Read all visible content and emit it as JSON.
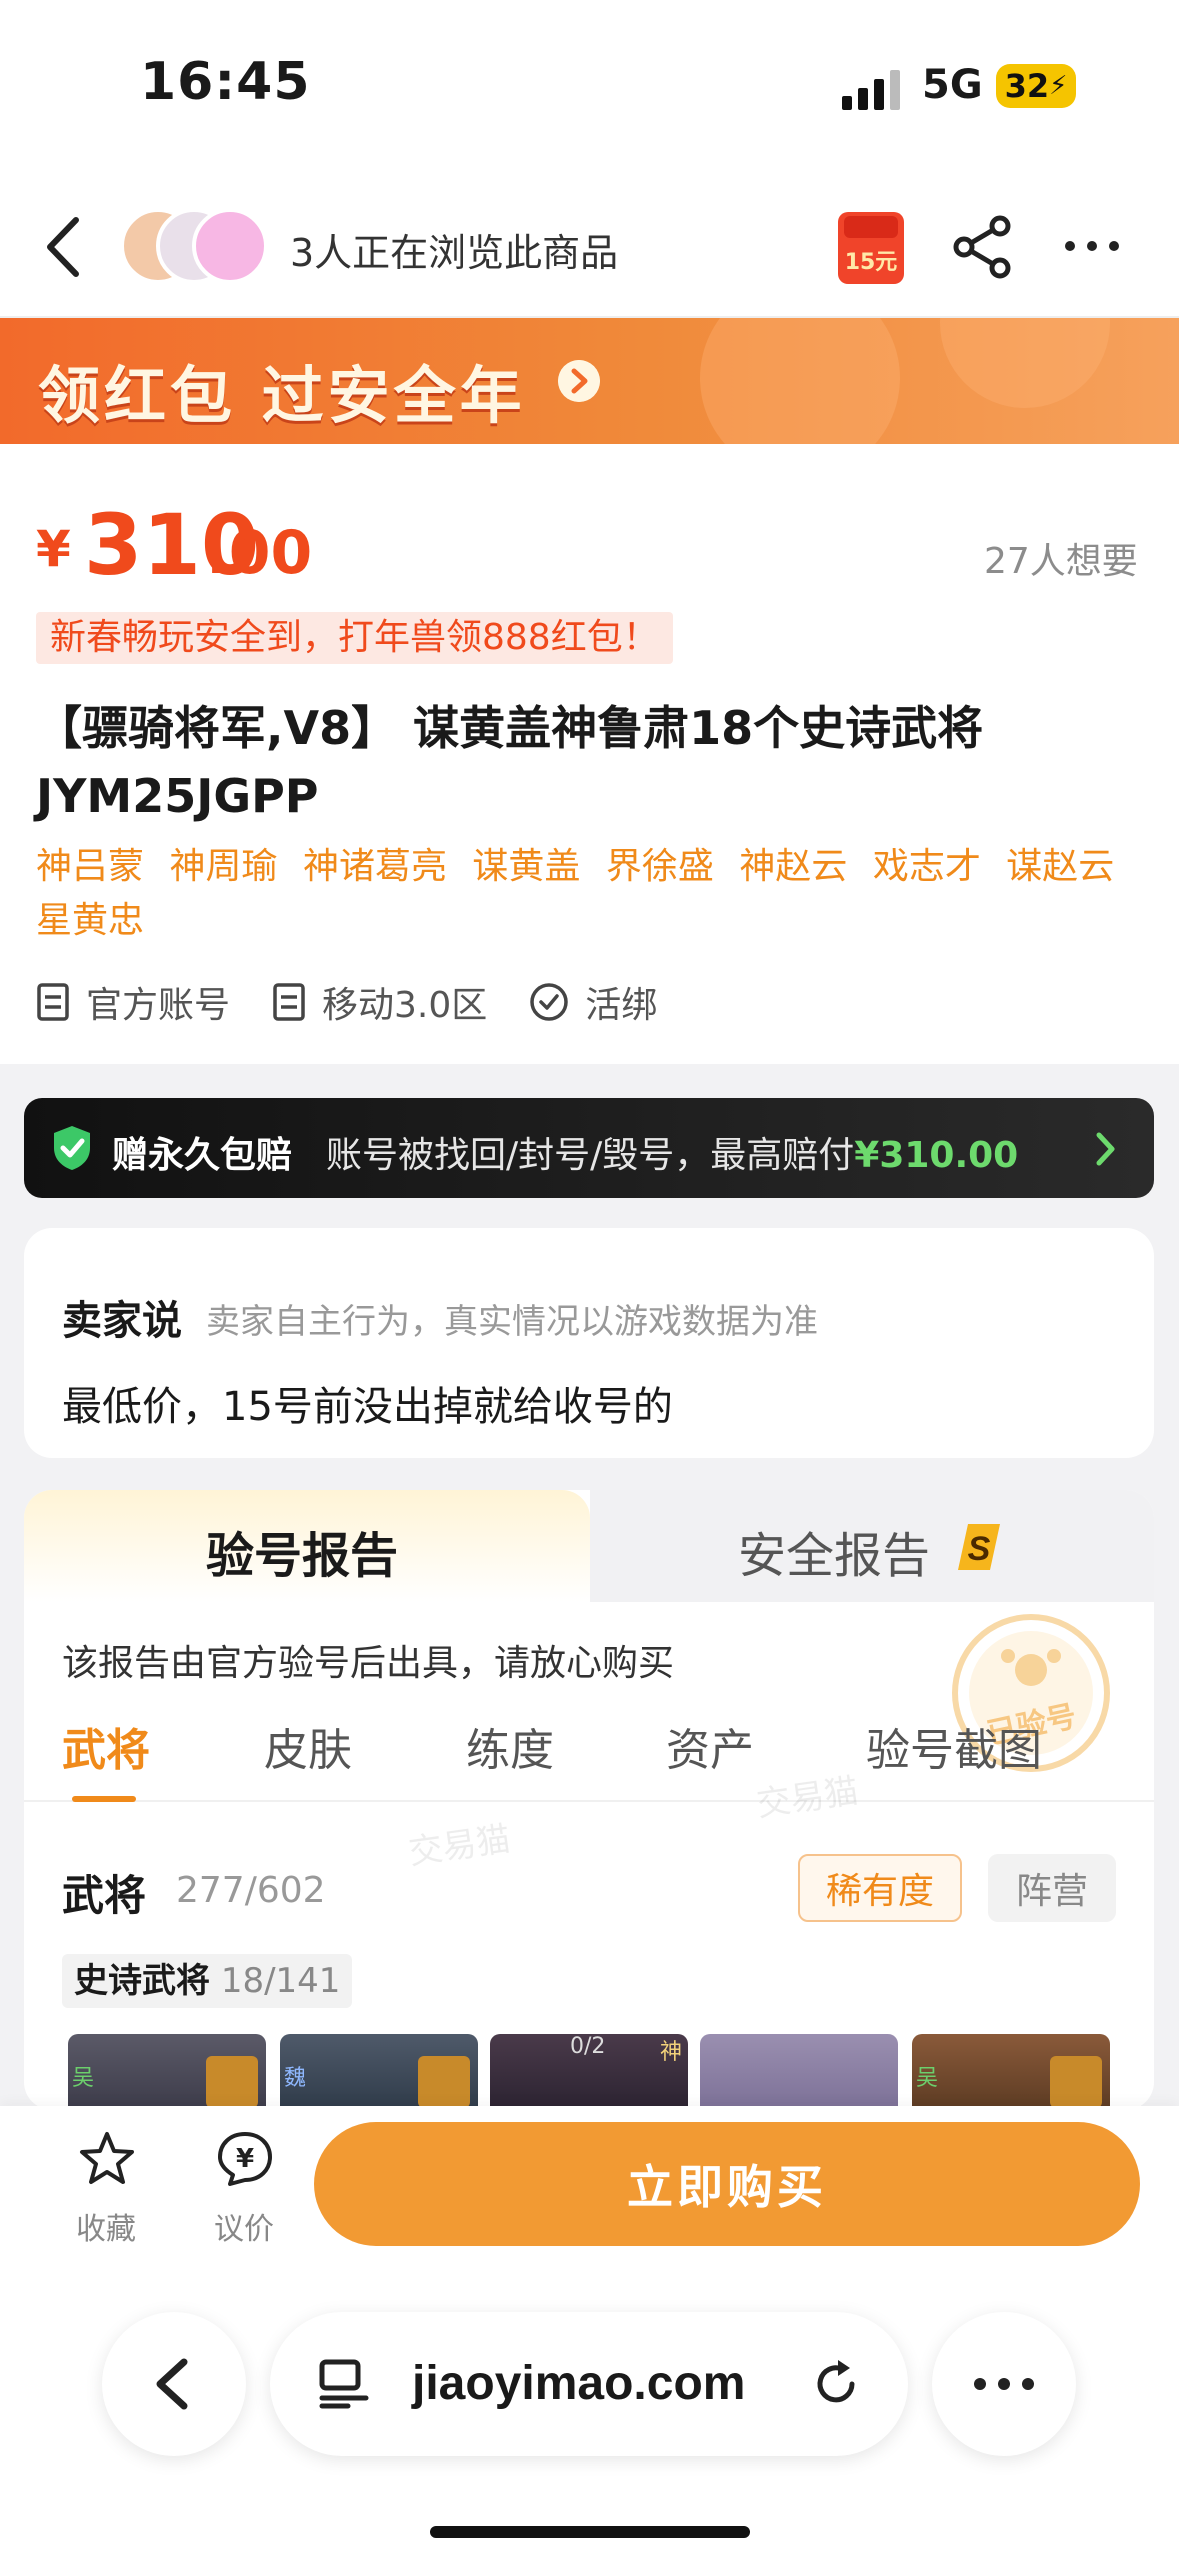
{
  "status_bar": {
    "time": "16:45",
    "network": "5G",
    "battery": "32"
  },
  "header": {
    "viewers_text": "3人正在浏览此商品",
    "coupon_label": "15元",
    "icons": [
      "back-icon",
      "coupon-icon",
      "share-icon",
      "more-icon"
    ]
  },
  "banner": {
    "text": "领红包 过安全年"
  },
  "product": {
    "price_symbol": "¥",
    "price_int": "310",
    "price_dec": ".00",
    "wanted": "27人想要",
    "promo": "新春畅玩安全到，打年兽领888红包！",
    "title": "【骠骑将军,V8】 谋黄盖神鲁肃18个史诗武将 JYM25JGPP",
    "tags": [
      "神吕蒙",
      "神周瑜",
      "神诸葛亮",
      "谋黄盖",
      "界徐盛",
      "神赵云",
      "戏志才",
      "谋赵云",
      "星黄忠"
    ],
    "attrs": [
      "官方账号",
      "移动3.0区",
      "活绑"
    ]
  },
  "insurance": {
    "title": "赠永久包赔",
    "desc": "账号被找回/封号/毁号，最高赔付",
    "amount": "¥310.00"
  },
  "seller": {
    "title": "卖家说",
    "subtitle": "卖家自主行为，真实情况以游戏数据为准",
    "text": "最低价，15号前没出掉就给收号的"
  },
  "report": {
    "tabs": [
      "验号报告",
      "安全报告"
    ],
    "note": "该报告由官方验号后出具，请放心购买",
    "stamp_text": "已验号",
    "watermark": "交易猫",
    "subtabs": [
      "武将",
      "皮肤",
      "练度",
      "资产",
      "验号截图"
    ],
    "heroes_label": "武将",
    "heroes_count": "277/602",
    "filter_rarity": "稀有度",
    "filter_camp": "阵营",
    "epic_label": "史诗武将",
    "epic_count": "18/141",
    "card_texts": [
      "吴",
      "魏",
      "0/2",
      "神",
      "吴"
    ]
  },
  "actionbar": {
    "fav_label": "收藏",
    "bargain_label": "议价",
    "buy_label": "立即购买"
  },
  "browser": {
    "url": "jiaoyimao.com"
  },
  "colors": {
    "accent": "#f04a1c",
    "orange": "#f08a1a",
    "buy": "#f29a33",
    "banner": "#f26a2b",
    "insure_amount": "#6dda6d"
  }
}
